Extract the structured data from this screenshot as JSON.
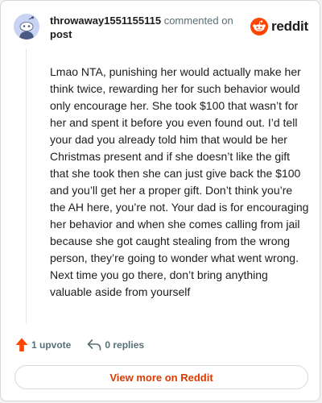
{
  "header": {
    "username": "throwaway1551155115",
    "action": "commented on",
    "post_link": "post",
    "brand": "reddit"
  },
  "comment": {
    "body": "Lmao NTA, punishing her would actually make her think twice, rewarding her for such behavior would only encourage her. She took $100 that wasn’t for her and spent it before you even found out. I’d tell your dad you already told him that would be her Christmas present and if she doesn’t like the gift that she took then she can just give back the $100 and you’ll get her a proper gift. Don’t think you’re the AH here, you’re not. Your dad is for encouraging her behavior and when she comes calling from jail because she got caught stealing from the wrong person, they’re going to wonder what went wrong. Next time you go there, don’t bring anything valuable aside from yourself"
  },
  "actions": {
    "upvotes": "1 upvote",
    "replies": "0 replies"
  },
  "footer": {
    "view_more": "View more on Reddit"
  },
  "colors": {
    "brand_orange": "#ff4500",
    "link_orange": "#d93a00",
    "muted_text": "#576f76",
    "avatar_bg": "#c9d3f3"
  },
  "icons": {
    "avatar": "snoo-avatar-icon",
    "brand": "reddit-logo-icon",
    "upvote": "upvote-arrow-icon",
    "reply": "reply-arrow-icon"
  }
}
